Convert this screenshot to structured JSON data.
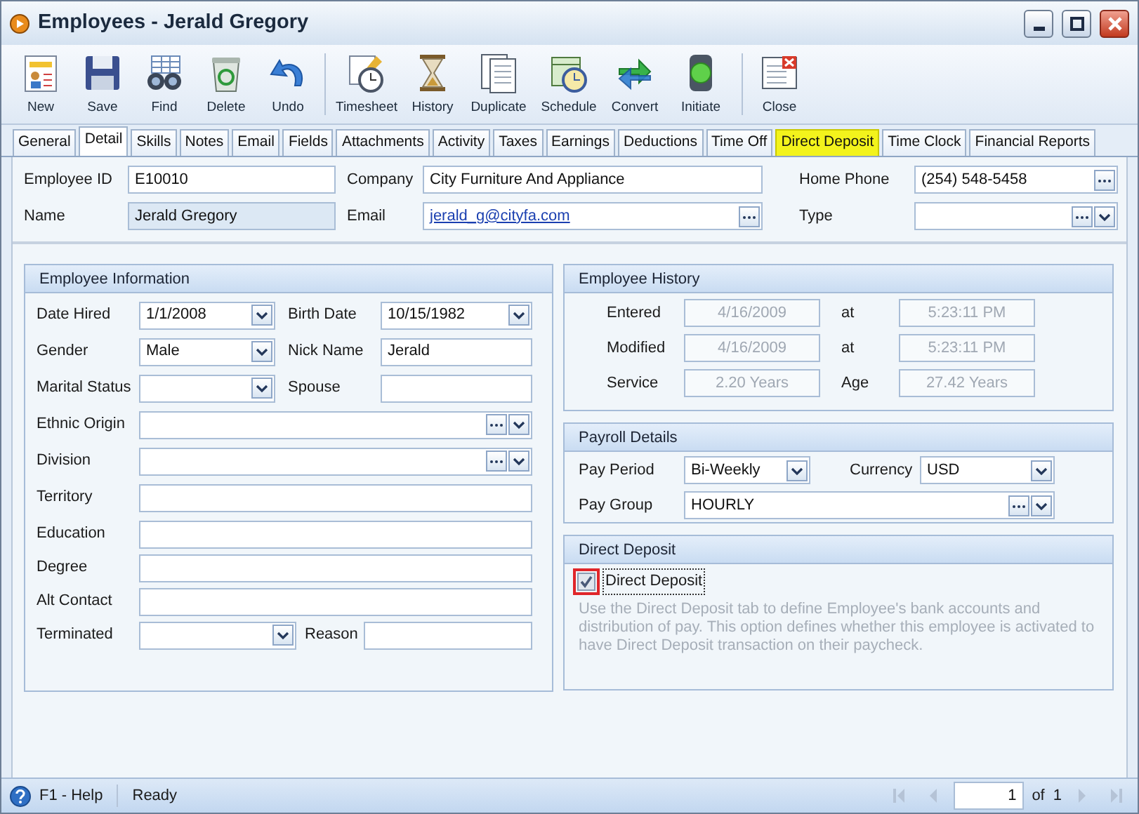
{
  "window": {
    "title": "Employees - Jerald Gregory"
  },
  "toolbar_groups": [
    [
      {
        "label": "New"
      },
      {
        "label": "Save"
      },
      {
        "label": "Find"
      },
      {
        "label": "Delete"
      },
      {
        "label": "Undo"
      }
    ],
    [
      {
        "label": "Timesheet"
      },
      {
        "label": "History"
      },
      {
        "label": "Duplicate"
      },
      {
        "label": "Schedule"
      },
      {
        "label": "Convert"
      },
      {
        "label": "Initiate"
      }
    ],
    [
      {
        "label": "Close"
      }
    ]
  ],
  "tabs": [
    {
      "label": "General",
      "selected": false,
      "highlighted": false
    },
    {
      "label": "Detail",
      "selected": true,
      "highlighted": false
    },
    {
      "label": "Skills",
      "selected": false,
      "highlighted": false
    },
    {
      "label": "Notes",
      "selected": false,
      "highlighted": false
    },
    {
      "label": "Email",
      "selected": false,
      "highlighted": false
    },
    {
      "label": "Fields",
      "selected": false,
      "highlighted": false
    },
    {
      "label": "Attachments",
      "selected": false,
      "highlighted": false
    },
    {
      "label": "Activity",
      "selected": false,
      "highlighted": false
    },
    {
      "label": "Taxes",
      "selected": false,
      "highlighted": false
    },
    {
      "label": "Earnings",
      "selected": false,
      "highlighted": false
    },
    {
      "label": "Deductions",
      "selected": false,
      "highlighted": false
    },
    {
      "label": "Time Off",
      "selected": false,
      "highlighted": false
    },
    {
      "label": "Direct Deposit",
      "selected": false,
      "highlighted": true
    },
    {
      "label": "Time Clock",
      "selected": false,
      "highlighted": false
    },
    {
      "label": "Financial Reports",
      "selected": false,
      "highlighted": false
    }
  ],
  "header_columns": [
    [
      {
        "label": "Employee ID",
        "value": "E10010",
        "kind": "text"
      },
      {
        "label": "Name",
        "value": "Jerald Gregory",
        "kind": "shaded"
      }
    ],
    [
      {
        "label": "Company",
        "value": "City Furniture And Appliance",
        "kind": "text"
      },
      {
        "label": "Email",
        "value": "jerald_g@cityfa.com",
        "kind": "link"
      }
    ],
    [
      {
        "label": "Home Phone",
        "value": "(254) 548-5458",
        "kind": "lookup"
      },
      {
        "label": "Type",
        "kind": "lookup_dropdown"
      }
    ]
  ],
  "employee_information": {
    "title": "Employee Information",
    "rows": [
      {
        "kind": "pair",
        "fields": [
          {
            "label": "Date Hired",
            "value": "1/1/2008",
            "kind": "dropdown"
          },
          {
            "label": "Birth Date",
            "value": "10/15/1982",
            "kind": "dropdown"
          }
        ]
      },
      {
        "kind": "pair",
        "fields": [
          {
            "label": "Gender",
            "value": "Male",
            "kind": "dropdown"
          },
          {
            "label": "Nick Name",
            "value": "Jerald",
            "kind": "text"
          }
        ]
      },
      {
        "kind": "pair",
        "fields": [
          {
            "label": "Marital Status",
            "kind": "dropdown"
          },
          {
            "label": "Spouse",
            "kind": "text"
          }
        ]
      },
      {
        "kind": "single",
        "fields": [
          {
            "label": "Ethnic Origin",
            "kind": "lookup_dropdown"
          }
        ]
      },
      {
        "kind": "single",
        "fields": [
          {
            "label": "Division",
            "kind": "lookup_dropdown"
          }
        ]
      },
      {
        "kind": "single",
        "fields": [
          {
            "label": "Territory",
            "kind": "text"
          }
        ]
      },
      {
        "kind": "single",
        "fields": [
          {
            "label": "Education",
            "kind": "text"
          }
        ]
      },
      {
        "kind": "single",
        "fields": [
          {
            "label": "Degree",
            "kind": "text"
          }
        ]
      },
      {
        "kind": "single",
        "fields": [
          {
            "label": "Alt Contact",
            "kind": "text"
          }
        ]
      },
      {
        "kind": "split",
        "fields": [
          {
            "label": "Terminated",
            "kind": "dropdown"
          },
          {
            "label": "Reason",
            "kind": "text"
          }
        ]
      }
    ]
  },
  "employee_history": {
    "title": "Employee History",
    "rows": [
      {
        "fields": [
          {
            "label": "Entered",
            "value": "4/16/2009",
            "kind": "readonly"
          },
          {
            "label": "at",
            "value": "5:23:11 PM",
            "kind": "readonly"
          }
        ]
      },
      {
        "fields": [
          {
            "label": "Modified",
            "value": "4/16/2009",
            "kind": "readonly"
          },
          {
            "label": "at",
            "value": "5:23:11 PM",
            "kind": "readonly"
          }
        ]
      },
      {
        "fields": [
          {
            "label": "Service",
            "value": "2.20 Years",
            "kind": "readonly"
          },
          {
            "label": "Age",
            "value": "27.42 Years",
            "kind": "readonly"
          }
        ]
      }
    ]
  },
  "payroll_details": {
    "title": "Payroll Details",
    "rows": [
      {
        "kind": "pair",
        "fields": [
          {
            "label": "Pay Period",
            "value": "Bi-Weekly",
            "kind": "dropdown"
          },
          {
            "label": "Currency",
            "value": "USD",
            "kind": "dropdown"
          }
        ]
      },
      {
        "kind": "single",
        "fields": [
          {
            "label": "Pay Group",
            "value": "HOURLY",
            "kind": "lookup_dropdown"
          }
        ]
      }
    ]
  },
  "direct_deposit": {
    "title": "Direct Deposit",
    "label": "Direct Deposit",
    "checked": true,
    "highlighted": true,
    "description": "Use the Direct Deposit tab to define Employee's bank accounts and distribution of pay. This option defines whether this employee is activated to have Direct Deposit transaction on their paycheck."
  },
  "status_bar": {
    "help": "F1 - Help",
    "status": "Ready",
    "page": "1",
    "of": "of",
    "total": "1",
    "nav_disabled": true
  }
}
